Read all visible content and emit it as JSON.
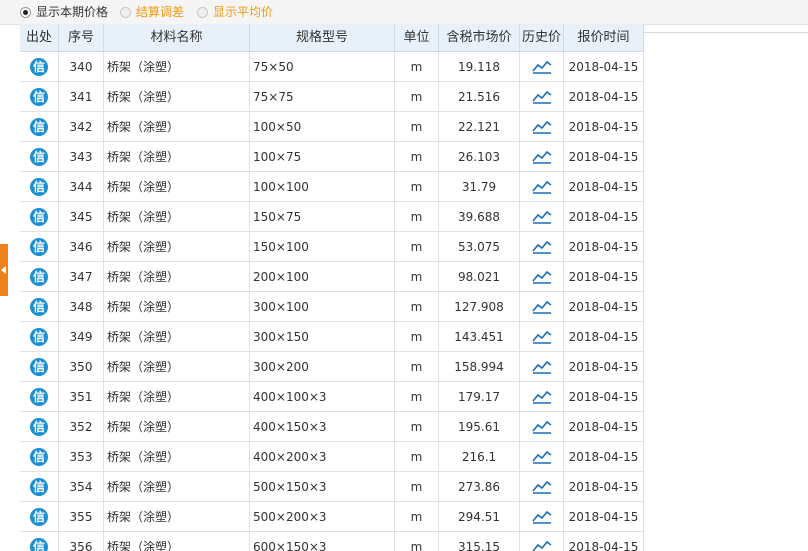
{
  "options": [
    {
      "label": "显示本期价格",
      "checked": true,
      "style": "normal"
    },
    {
      "label": "结算调差",
      "checked": false,
      "style": "orange"
    },
    {
      "label": "显示平均价",
      "checked": false,
      "style": "orange"
    }
  ],
  "table": {
    "headers": [
      "出处",
      "序号",
      "材料名称",
      "规格型号",
      "单位",
      "含税市场价",
      "历史价",
      "报价时间"
    ],
    "source_badge": "信",
    "rows": [
      {
        "no": "340",
        "name": "桥架（涂塑）",
        "spec": "75×50",
        "unit": "m",
        "price": "19.118",
        "date": "2018-04-15"
      },
      {
        "no": "341",
        "name": "桥架（涂塑）",
        "spec": "75×75",
        "unit": "m",
        "price": "21.516",
        "date": "2018-04-15"
      },
      {
        "no": "342",
        "name": "桥架（涂塑）",
        "spec": "100×50",
        "unit": "m",
        "price": "22.121",
        "date": "2018-04-15"
      },
      {
        "no": "343",
        "name": "桥架（涂塑）",
        "spec": "100×75",
        "unit": "m",
        "price": "26.103",
        "date": "2018-04-15"
      },
      {
        "no": "344",
        "name": "桥架（涂塑）",
        "spec": "100×100",
        "unit": "m",
        "price": "31.79",
        "date": "2018-04-15"
      },
      {
        "no": "345",
        "name": "桥架（涂塑）",
        "spec": "150×75",
        "unit": "m",
        "price": "39.688",
        "date": "2018-04-15"
      },
      {
        "no": "346",
        "name": "桥架（涂塑）",
        "spec": "150×100",
        "unit": "m",
        "price": "53.075",
        "date": "2018-04-15"
      },
      {
        "no": "347",
        "name": "桥架（涂塑）",
        "spec": "200×100",
        "unit": "m",
        "price": "98.021",
        "date": "2018-04-15"
      },
      {
        "no": "348",
        "name": "桥架（涂塑）",
        "spec": "300×100",
        "unit": "m",
        "price": "127.908",
        "date": "2018-04-15"
      },
      {
        "no": "349",
        "name": "桥架（涂塑）",
        "spec": "300×150",
        "unit": "m",
        "price": "143.451",
        "date": "2018-04-15"
      },
      {
        "no": "350",
        "name": "桥架（涂塑）",
        "spec": "300×200",
        "unit": "m",
        "price": "158.994",
        "date": "2018-04-15"
      },
      {
        "no": "351",
        "name": "桥架（涂塑）",
        "spec": "400×100×3",
        "unit": "m",
        "price": "179.17",
        "date": "2018-04-15"
      },
      {
        "no": "352",
        "name": "桥架（涂塑）",
        "spec": "400×150×3",
        "unit": "m",
        "price": "195.61",
        "date": "2018-04-15"
      },
      {
        "no": "353",
        "name": "桥架（涂塑）",
        "spec": "400×200×3",
        "unit": "m",
        "price": "216.1",
        "date": "2018-04-15"
      },
      {
        "no": "354",
        "name": "桥架（涂塑）",
        "spec": "500×150×3",
        "unit": "m",
        "price": "273.86",
        "date": "2018-04-15"
      },
      {
        "no": "355",
        "name": "桥架（涂塑）",
        "spec": "500×200×3",
        "unit": "m",
        "price": "294.51",
        "date": "2018-04-15"
      },
      {
        "no": "356",
        "name": "桥架（涂塑）",
        "spec": "600×150×3",
        "unit": "m",
        "price": "315.15",
        "date": "2018-04-15"
      }
    ]
  },
  "icons": {
    "source": "xin-badge-icon",
    "history": "line-chart-icon",
    "side_tab": "chevron-left-icon"
  },
  "colors": {
    "accent_orange": "#f0821e",
    "option_orange": "#f39c12",
    "badge_blue": "#1a8fd6",
    "header_bg": "#e8f1fa"
  }
}
